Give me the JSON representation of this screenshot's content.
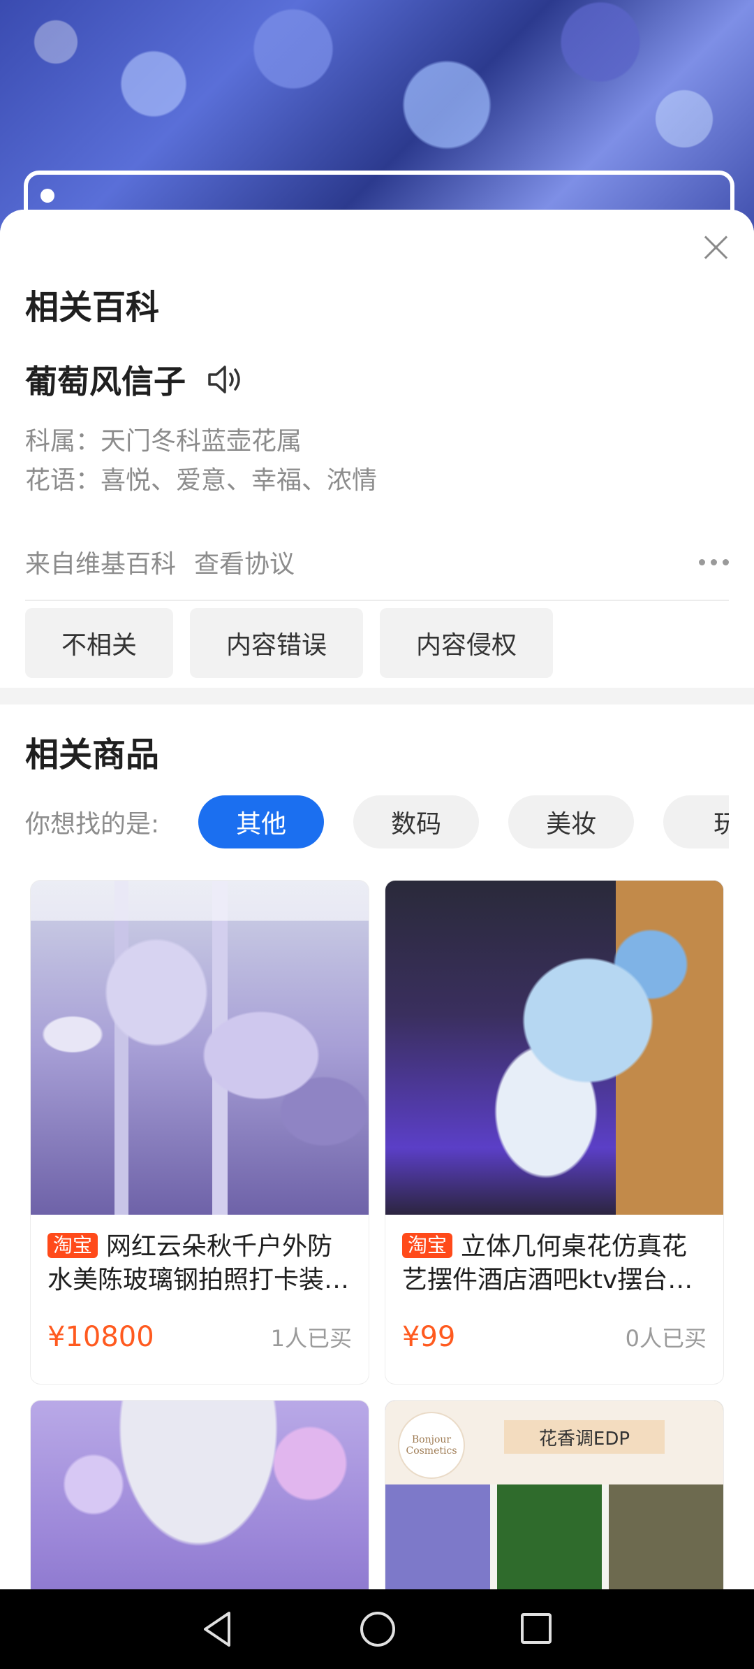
{
  "wiki": {
    "section_title": "相关百科",
    "name": "葡萄风信子",
    "family_line": "科属：天门冬科蓝壶花属",
    "language_line": "花语：喜悦、爱意、幸福、浓情",
    "source": "来自维基百科",
    "agreement": "查看协议",
    "feedback": [
      "不相关",
      "内容错误",
      "内容侵权"
    ]
  },
  "goods": {
    "section_title": "相关商品",
    "filter_label": "你想找的是:",
    "chips": [
      "其他",
      "数码",
      "美妆",
      "玩"
    ],
    "active_chip": "其他",
    "accent_color": "#1b6ff0",
    "price_color": "#ff5a1f",
    "products": [
      {
        "badge": "淘宝",
        "title": "网红云朵秋千户外防水美陈玻璃钢拍照打卡装…",
        "price": "¥10800",
        "sold": "1人已买"
      },
      {
        "badge": "淘宝",
        "title": "立体几何桌花仿真花艺摆件酒店酒吧ktv摆台…",
        "price": "¥99",
        "sold": "0人已买"
      },
      {
        "badge": "",
        "title": "",
        "price": "",
        "sold": ""
      },
      {
        "badge": "",
        "title": "",
        "price": "",
        "sold": "",
        "image_logo": "Bonjour Cosmetics",
        "image_label": "花香调EDP"
      }
    ]
  },
  "icons": {
    "close": "close-icon",
    "speaker": "speaker-icon",
    "more": "more-icon",
    "nav_back": "nav-back-icon",
    "nav_home": "nav-home-icon",
    "nav_recent": "nav-recent-icon"
  }
}
